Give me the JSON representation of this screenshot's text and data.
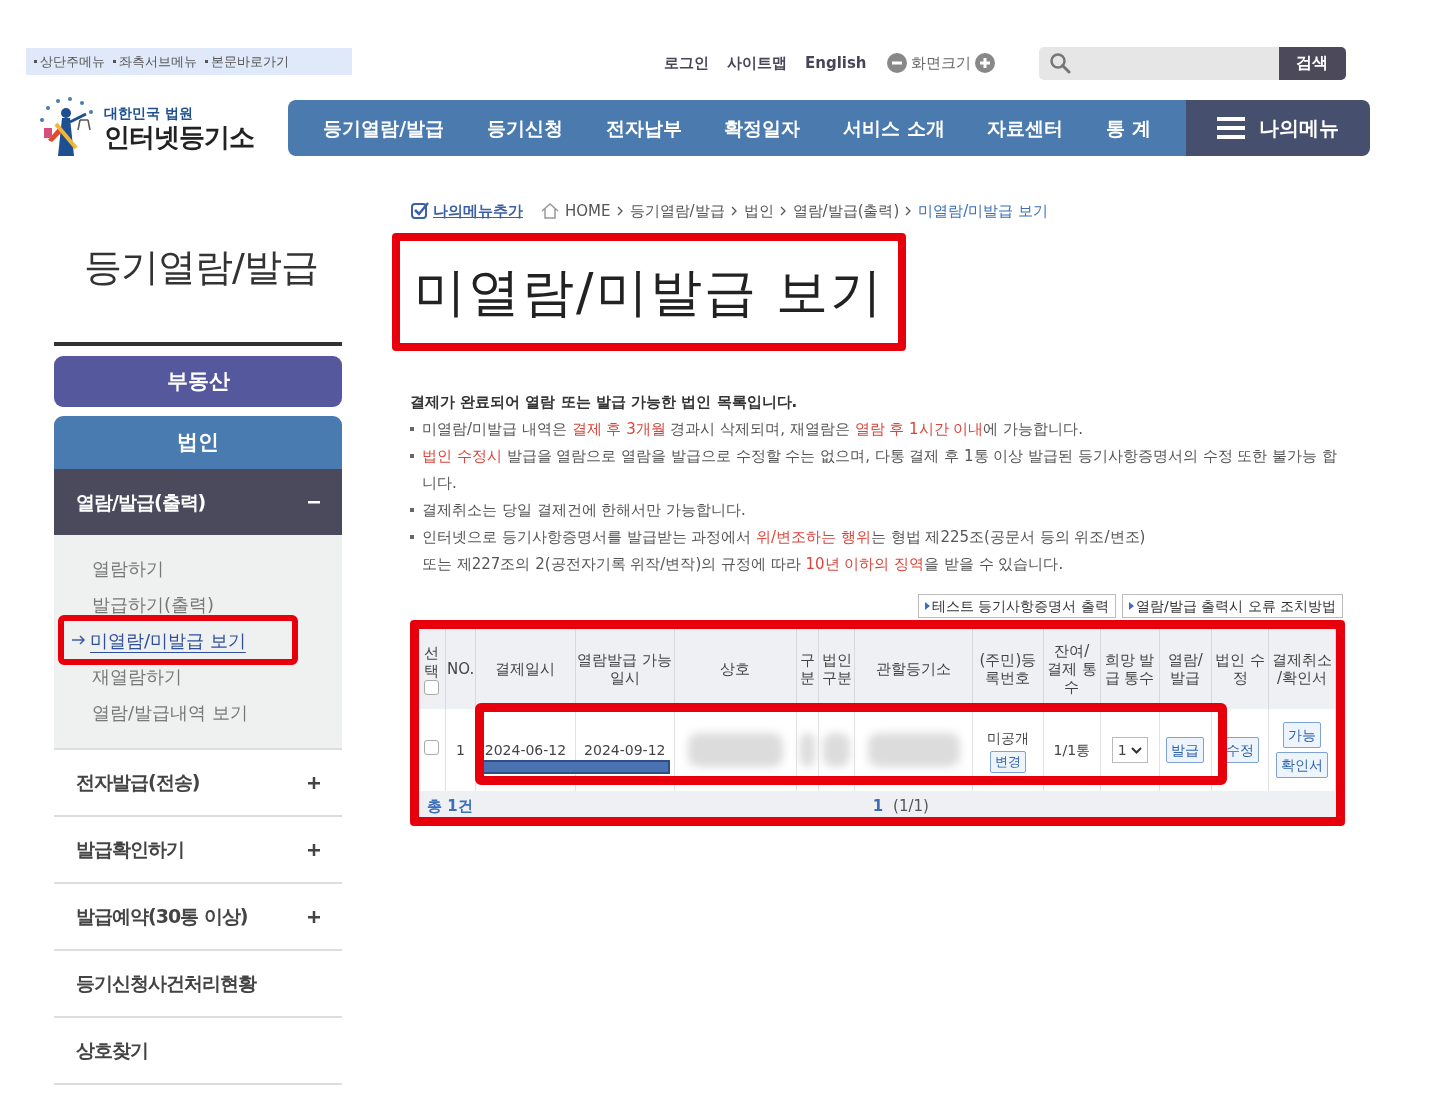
{
  "skip_links": [
    "상단주메뉴",
    "좌측서브메뉴",
    "본문바로가기"
  ],
  "logo": {
    "subtitle": "대한민국 법원",
    "title": "인터넷등기소"
  },
  "utility_links": [
    "로그인",
    "사이트맵",
    "English"
  ],
  "zoom_label": "화면크기",
  "search": {
    "button": "검색"
  },
  "nav": [
    "등기열람/발급",
    "등기신청",
    "전자납부",
    "확정일자",
    "서비스 소개",
    "자료센터",
    "통 계"
  ],
  "my_menu": "나의메뉴",
  "breadcrumb": {
    "add_menu": "나의메뉴추가",
    "items": [
      {
        "label": "HOME",
        "current": false
      },
      {
        "label": "등기열람/발급",
        "current": false
      },
      {
        "label": "법인",
        "current": false
      },
      {
        "label": "열람/발급(출력)",
        "current": false
      },
      {
        "label": "미열람/미발급 보기",
        "current": true
      }
    ]
  },
  "sidebar": {
    "title": "등기열람/발급",
    "categories": [
      {
        "label": "부동산",
        "selected": false
      },
      {
        "label": "법인",
        "selected": true
      }
    ],
    "sections": [
      {
        "label": "열람/발급(출력)",
        "kind": "group",
        "expanded": true,
        "children": [
          {
            "label": "열람하기",
            "selected": false,
            "highlighted": false
          },
          {
            "label": "발급하기(출력)",
            "selected": false,
            "highlighted": false
          },
          {
            "label": "미열람/미발급 보기",
            "selected": true,
            "highlighted": true
          },
          {
            "label": "재열람하기",
            "selected": false,
            "highlighted": false
          },
          {
            "label": "열람/발급내역 보기",
            "selected": false,
            "highlighted": false
          }
        ]
      },
      {
        "label": "전자발급(전송)",
        "kind": "group",
        "expanded": false
      },
      {
        "label": "발급확인하기",
        "kind": "group",
        "expanded": false
      },
      {
        "label": "발급예약(30통 이상)",
        "kind": "group",
        "expanded": false
      },
      {
        "label": "등기신청사건처리현황",
        "kind": "link"
      },
      {
        "label": "상호찾기",
        "kind": "link"
      }
    ]
  },
  "page_title": {
    "text": "미열람/미발급 보기",
    "highlighted": true
  },
  "notice": {
    "heading": "결제가 완료되어 열람 또는 발급 가능한 법인 목록입니다.",
    "items": [
      {
        "bullet": true,
        "segments": [
          {
            "text": "미열람/미발급 내역은 ",
            "highlight": false
          },
          {
            "text": "결제 후 3개월",
            "highlight": true
          },
          {
            "text": " 경과시 삭제되며, 재열람은 ",
            "highlight": false
          },
          {
            "text": "열람 후 1시간 이내",
            "highlight": true
          },
          {
            "text": "에 가능합니다.",
            "highlight": false
          }
        ]
      },
      {
        "bullet": true,
        "segments": [
          {
            "text": "법인 수정시",
            "highlight": true
          },
          {
            "text": " 발급을 열람으로 열람을 발급으로 수정할 수는 없으며, 다통 결제 후 1통 이상 발급된 등기사항증명서의 수정 또한 불가능 합니다.",
            "highlight": false
          }
        ]
      },
      {
        "bullet": true,
        "segments": [
          {
            "text": "결제취소는 당일 결제건에 한해서만 가능합니다.",
            "highlight": false
          }
        ]
      },
      {
        "bullet": true,
        "segments": [
          {
            "text": "인터넷으로 등기사항증명서를 발급받는 과정에서 ",
            "highlight": false
          },
          {
            "text": "위/변조하는 행위",
            "highlight": true
          },
          {
            "text": "는 형법 제225조(공문서 등의 위조/변조)",
            "highlight": false
          }
        ]
      },
      {
        "bullet": false,
        "segments": [
          {
            "text": "또는 제227조의 2(공전자기록 위작/변작)의 규정에 따라 ",
            "highlight": false
          },
          {
            "text": "10년 이하의 징역",
            "highlight": true
          },
          {
            "text": "을 받을 수 있습니다.",
            "highlight": false
          }
        ]
      }
    ]
  },
  "action_buttons": [
    "테스트 등기사항증명서 출력",
    "열람/발급 출력시 오류 조치방법"
  ],
  "table": {
    "highlighted": true,
    "select_all_checked": false,
    "columns": [
      "선택",
      "NO.",
      "결제일시",
      "열람발급 가능일시",
      "상호",
      "구분",
      "법인 구분",
      "관할등기소",
      "(주민)등록번호",
      "잔여/ 결제 통수",
      "희망 발급 통수",
      "열람/ 발급",
      "법인 수정",
      "결제취소 /확인서"
    ],
    "rows": [
      {
        "highlighted": true,
        "redacted": true,
        "cells": [
          {
            "kind": "checkbox",
            "checked": false
          },
          {
            "kind": "text",
            "text": "1"
          },
          {
            "kind": "text",
            "text": "2024-06-12"
          },
          {
            "kind": "text",
            "text": "2024-09-12"
          },
          {
            "kind": "blurred"
          },
          {
            "kind": "blurred"
          },
          {
            "kind": "blurred"
          },
          {
            "kind": "blurred"
          },
          {
            "kind": "text_button",
            "text": "미공개",
            "button": "변경"
          },
          {
            "kind": "text",
            "text": "1/1통"
          },
          {
            "kind": "select",
            "value": "1"
          },
          {
            "kind": "buttons",
            "buttons": [
              "발급"
            ]
          },
          {
            "kind": "buttons",
            "buttons": [
              "수정"
            ]
          },
          {
            "kind": "buttons",
            "buttons": [
              "가능",
              "확인서"
            ]
          }
        ]
      }
    ],
    "total": "총 1건",
    "page": "1",
    "page_info": "(1/1)"
  }
}
